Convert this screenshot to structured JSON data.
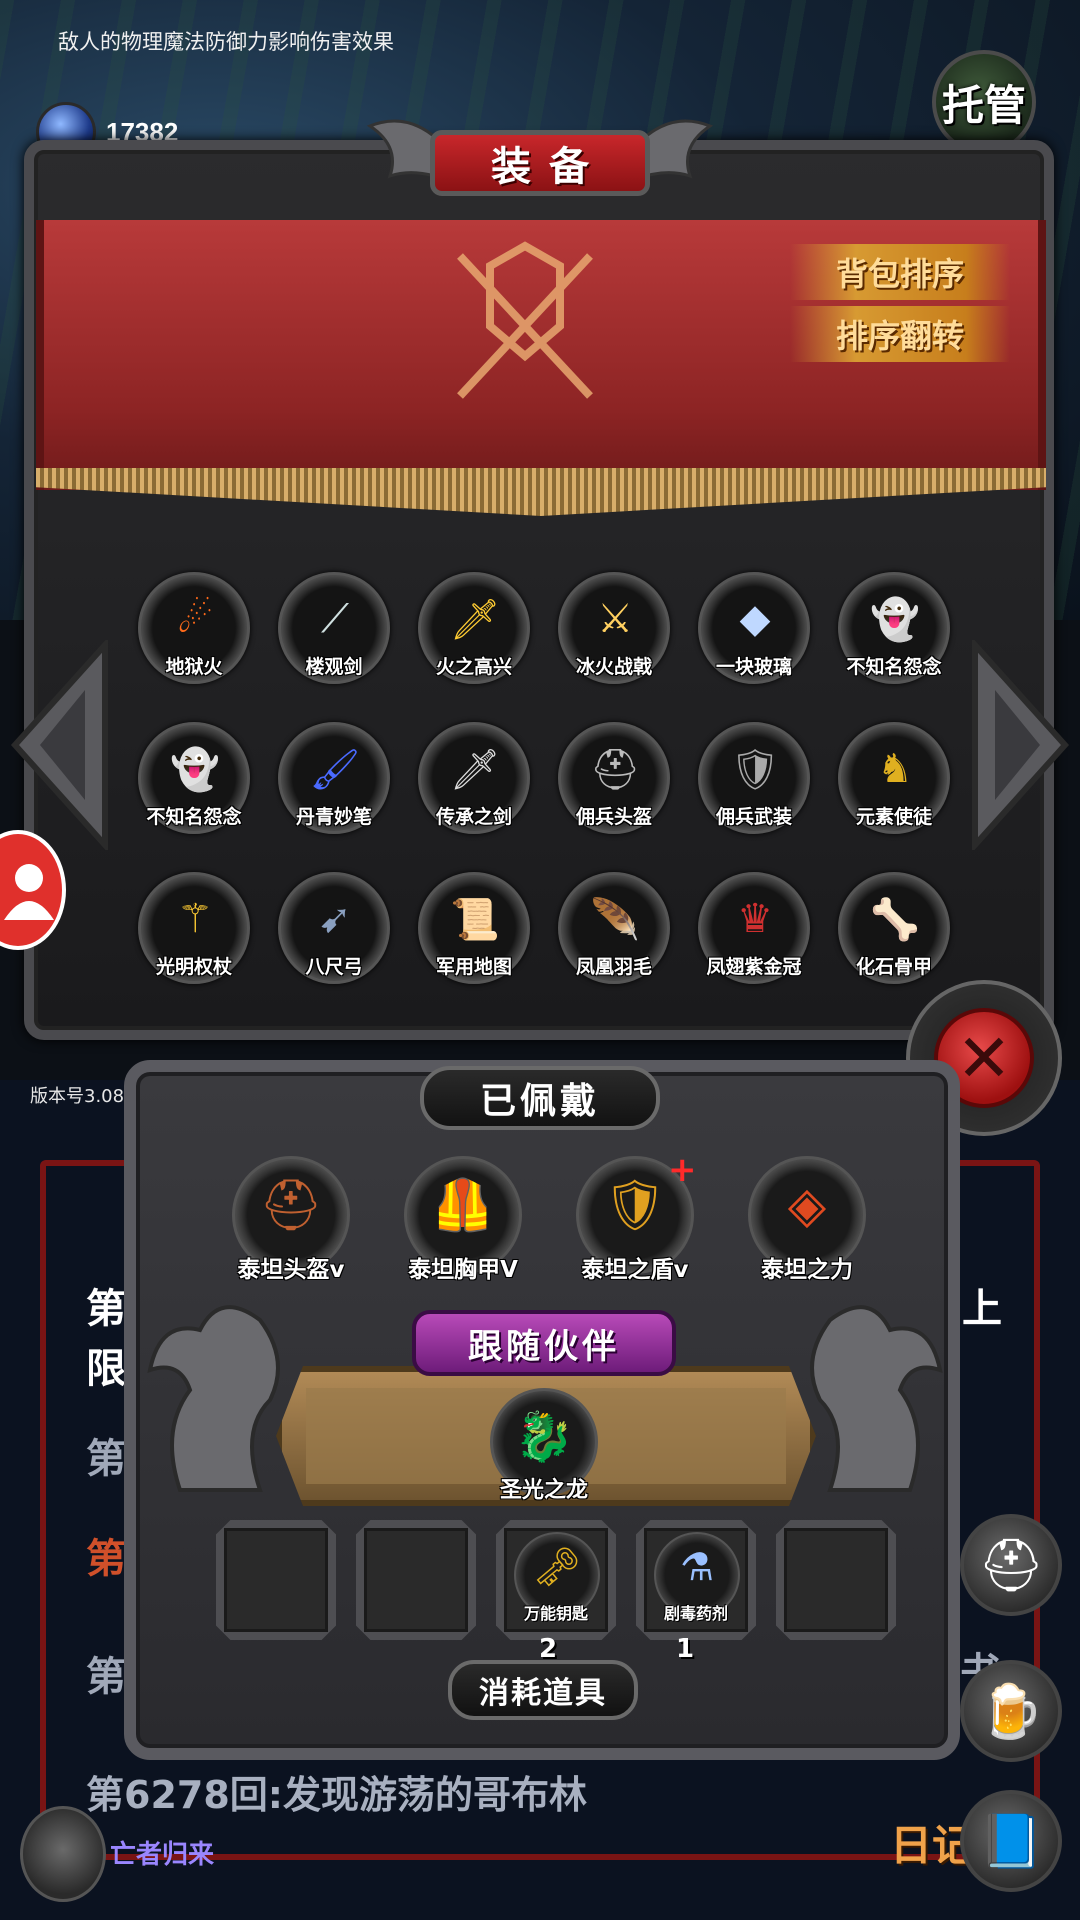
{
  "notice": "敌人的物理魔法防御力影响伤害效果",
  "gem": {
    "label": "宝石",
    "count": "17382"
  },
  "autoplay": {
    "label": "托管"
  },
  "equip_panel": {
    "title": "装备",
    "sort_label": "背包排序",
    "reverse_label": "排序翻转",
    "items": [
      {
        "name": "地狱火",
        "icon": "fireball-icon",
        "glyph": "☄",
        "color": "#ff6a1a"
      },
      {
        "name": "楼观剑",
        "icon": "curved-blade-icon",
        "glyph": "⟋",
        "color": "#cfe0e0"
      },
      {
        "name": "火之高兴",
        "icon": "golden-sword-icon",
        "glyph": "🗡",
        "color": "#ffcc33"
      },
      {
        "name": "冰火战戟",
        "icon": "halberd-icon",
        "glyph": "⚔",
        "color": "#ffd060"
      },
      {
        "name": "一块玻璃",
        "icon": "glass-shard-icon",
        "glyph": "◆",
        "color": "#bfd8ff"
      },
      {
        "name": "不知名怨念",
        "icon": "ghost-icon",
        "glyph": "👻",
        "color": "#ffffff"
      },
      {
        "name": "不知名怨念",
        "icon": "ghost-icon",
        "glyph": "👻",
        "color": "#ffffff"
      },
      {
        "name": "丹青妙笔",
        "icon": "magic-brush-icon",
        "glyph": "🖌",
        "color": "#4a6aff"
      },
      {
        "name": "传承之剑",
        "icon": "sword-icon",
        "glyph": "🗡",
        "color": "#dddddd"
      },
      {
        "name": "佣兵头盔",
        "icon": "helmet-icon",
        "glyph": "⛑",
        "color": "#bbbbbb"
      },
      {
        "name": "佣兵武装",
        "icon": "armor-set-icon",
        "glyph": "🛡",
        "color": "#aaaaaa"
      },
      {
        "name": "元素使徒",
        "icon": "golden-figure-icon",
        "glyph": "♞",
        "color": "#e0b020"
      },
      {
        "name": "光明权杖",
        "icon": "scepter-icon",
        "glyph": "⚚",
        "color": "#ffcc33"
      },
      {
        "name": "八尺弓",
        "icon": "bow-icon",
        "glyph": "➹",
        "color": "#8aa0c0"
      },
      {
        "name": "军用地图",
        "icon": "map-scroll-icon",
        "glyph": "📜",
        "color": "#e8c860"
      },
      {
        "name": "凤凰羽毛",
        "icon": "feather-icon",
        "glyph": "🪶",
        "color": "#ff8a40"
      },
      {
        "name": "凤翅紫金冠",
        "icon": "crown-icon",
        "glyph": "♛",
        "color": "#d03030"
      },
      {
        "name": "化石骨甲",
        "icon": "bone-icon",
        "glyph": "🦴",
        "color": "#f0e0d0"
      }
    ]
  },
  "version": "版本号3.08",
  "worn": {
    "title": "已佩戴",
    "items": [
      {
        "name": "泰坦头盔v",
        "icon": "titan-helmet-icon",
        "glyph": "⛑",
        "color": "#c06030"
      },
      {
        "name": "泰坦胸甲V",
        "icon": "titan-chestplate-icon",
        "glyph": "🦺",
        "color": "#d09020"
      },
      {
        "name": "泰坦之盾v",
        "icon": "titan-shield-icon",
        "glyph": "🛡",
        "color": "#e0a020",
        "badge": "+"
      },
      {
        "name": "泰坦之力",
        "icon": "lava-stone-icon",
        "glyph": "◈",
        "color": "#e04a20"
      }
    ]
  },
  "companion": {
    "title": "跟随伙伴",
    "name": "圣光之龙",
    "icon": "golden-dragon-icon",
    "glyph": "🐉",
    "color": "#e0b020"
  },
  "consumables": {
    "title": "消耗道具",
    "items": [
      {
        "name": "",
        "count": ""
      },
      {
        "name": "",
        "count": ""
      },
      {
        "name": "万能钥匙",
        "icon": "key-icon",
        "glyph": "🗝",
        "color": "#e0b020",
        "count": "2"
      },
      {
        "name": "剧毒药剂",
        "icon": "poison-potion-icon",
        "glyph": "⚗",
        "color": "#9ac0ff",
        "count": "1"
      },
      {
        "name": "",
        "count": ""
      }
    ]
  },
  "story": {
    "line1": "第",
    "line1b": "限",
    "line1r": "上",
    "line2": "第",
    "line3": "第",
    "line4": "第",
    "line_right": "书",
    "line5": "第6278回:发现游荡的哥布林"
  },
  "hero": {
    "label": "亡者归来"
  },
  "diary": {
    "label": "日记"
  }
}
